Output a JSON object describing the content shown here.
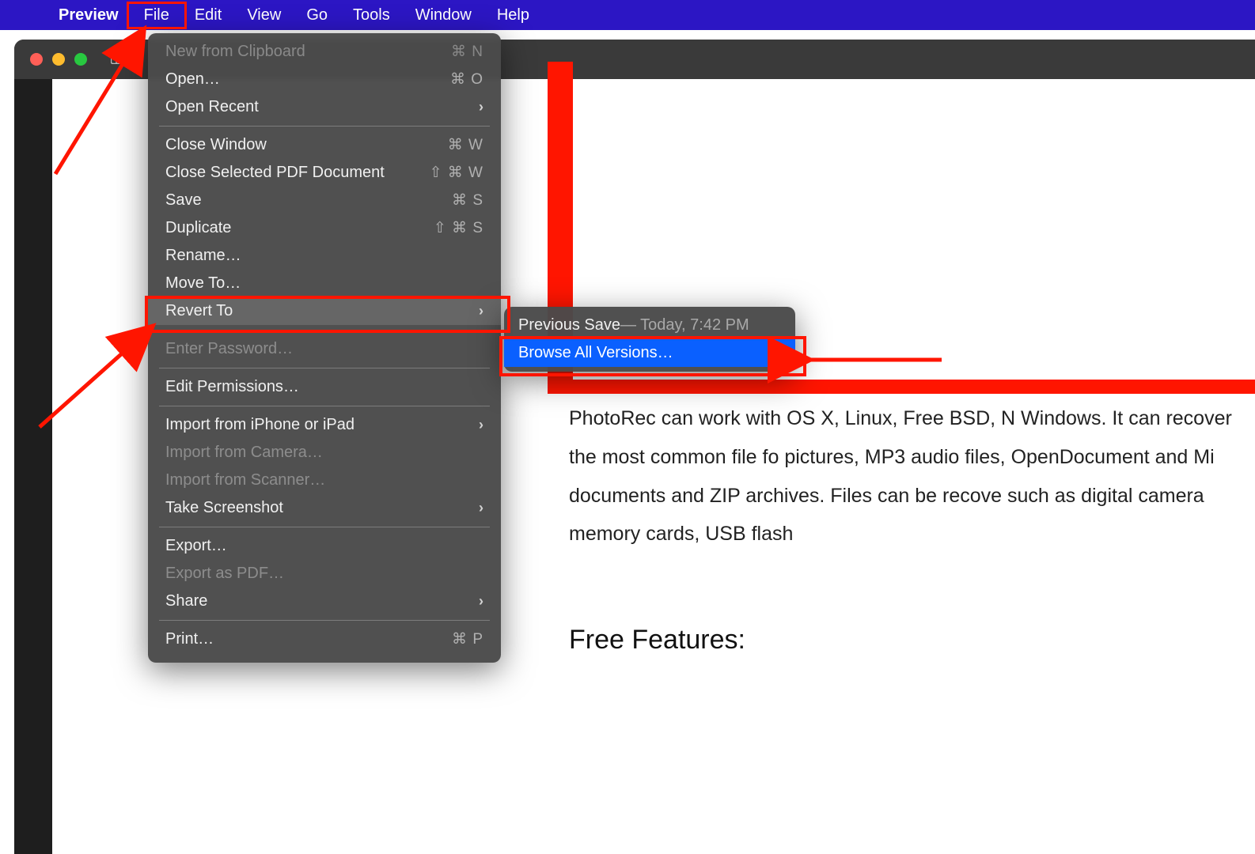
{
  "menubar": {
    "app": "Preview",
    "items": [
      "File",
      "Edit",
      "View",
      "Go",
      "Tools",
      "Window",
      "Help"
    ]
  },
  "file_menu": {
    "groups": [
      [
        {
          "label": "New from Clipboard",
          "shortcut": "⌘ N",
          "disabled": true
        },
        {
          "label": "Open…",
          "shortcut": "⌘ O"
        },
        {
          "label": "Open Recent",
          "submenu": true
        }
      ],
      [
        {
          "label": "Close Window",
          "shortcut": "⌘ W"
        },
        {
          "label": "Close Selected PDF Document",
          "shortcut": "⇧ ⌘ W"
        },
        {
          "label": "Save",
          "shortcut": "⌘ S"
        },
        {
          "label": "Duplicate",
          "shortcut": "⇧ ⌘ S"
        },
        {
          "label": "Rename…"
        },
        {
          "label": "Move To…"
        },
        {
          "label": "Revert To",
          "submenu": true,
          "hover": true
        }
      ],
      [
        {
          "label": "Enter Password…",
          "disabled": true
        }
      ],
      [
        {
          "label": "Edit Permissions…"
        }
      ],
      [
        {
          "label": "Import from iPhone or iPad",
          "submenu": true
        },
        {
          "label": "Import from Camera…",
          "disabled": true
        },
        {
          "label": "Import from Scanner…",
          "disabled": true
        },
        {
          "label": "Take Screenshot",
          "submenu": true
        }
      ],
      [
        {
          "label": "Export…"
        },
        {
          "label": "Export as PDF…",
          "disabled": true
        },
        {
          "label": "Share",
          "submenu": true
        }
      ],
      [
        {
          "label": "Print…",
          "shortcut": "⌘ P"
        }
      ]
    ]
  },
  "revert_submenu": {
    "previous_label": "Previous Save",
    "previous_detail": " — Today, 7:42 PM",
    "browse_label": "Browse All Versions…"
  },
  "document": {
    "body": "PhotoRec can work with OS X, Linux, Free BSD, N Windows. It can recover the most common file fo pictures, MP3 audio files, OpenDocument and Mi documents and ZIP archives. Files can be recove such as digital camera memory cards, USB flash",
    "heading": "Free Features:"
  }
}
